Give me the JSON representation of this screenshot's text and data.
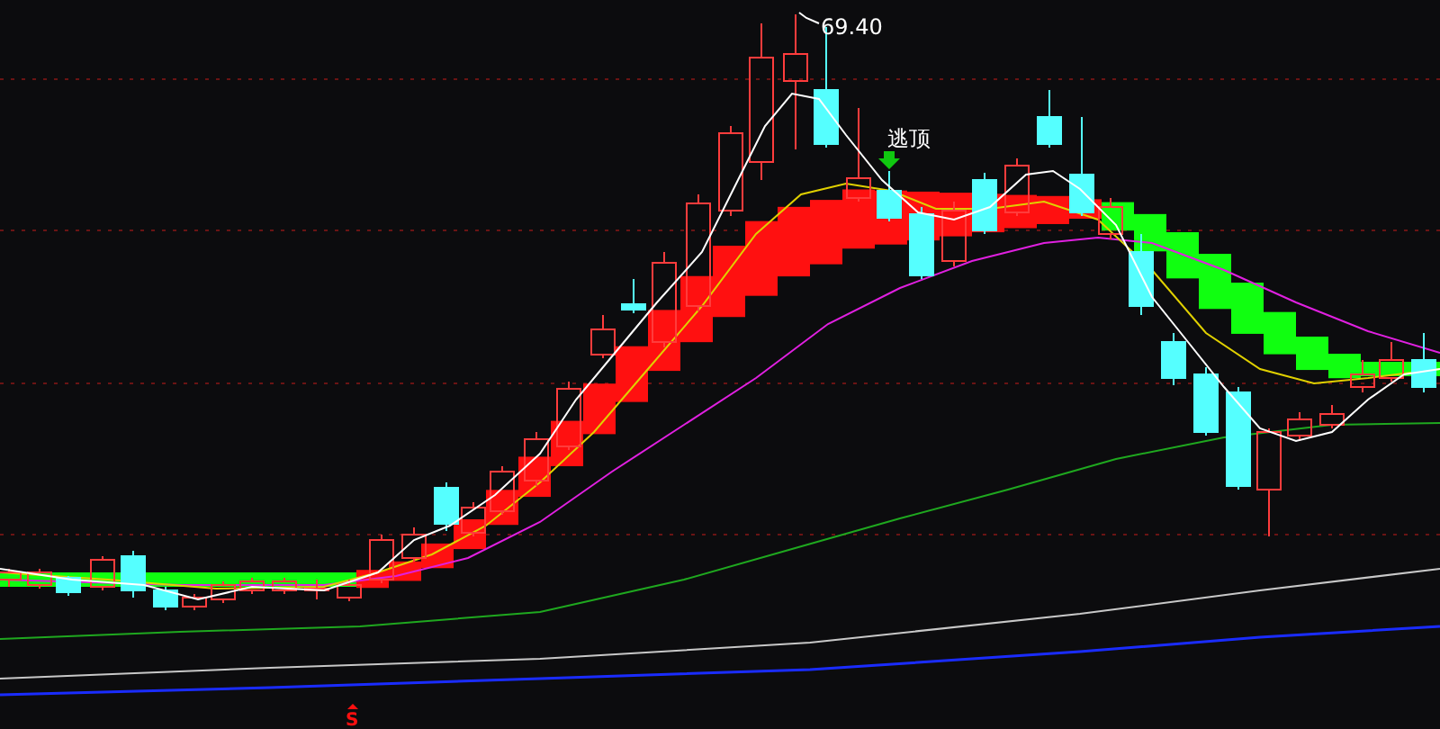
{
  "chart": {
    "high_label": "69.40",
    "signal_label": "逃顶",
    "marker_label": "S"
  }
}
